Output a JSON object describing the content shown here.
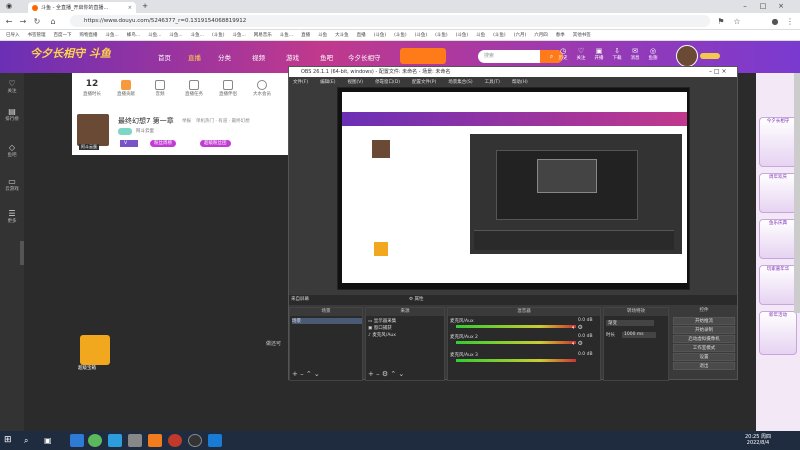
{
  "browser": {
    "tab_title": "斗鱼 - 全直播_开启你的直播...",
    "url": "https://www.douyu.com/5246377_r=0.1319154068819912",
    "bookmarks": [
      "已导入",
      "书签管理",
      "百度一下",
      "购物直播",
      "斗鱼...",
      "蜂鸟...",
      "斗鱼...",
      "斗鱼...",
      "斗鱼...",
      "(斗鱼)",
      "斗鱼...",
      "网易音乐",
      "斗鱼...",
      "直播",
      "斗鱼",
      "大斗鱼",
      "直播",
      "(斗鱼)",
      "(斗鱼)",
      "(斗鱼)",
      "(斗鱼)",
      "(斗鱼)",
      "斗鱼",
      "(斗鱼)",
      "(六月)",
      "六月四",
      "春季",
      "其他书签"
    ]
  },
  "site": {
    "logo": "今夕长相守 斗鱼",
    "nav": [
      "首页",
      "直播",
      "分类",
      "视频",
      "游戏",
      "鱼吧",
      "今夕长相守"
    ],
    "search_placeholder": "搜索",
    "header_icons": [
      {
        "label": "历史",
        "icon": "clock-icon"
      },
      {
        "label": "关注",
        "icon": "heart-icon"
      },
      {
        "label": "开播",
        "icon": "camera-icon"
      },
      {
        "label": "下载",
        "icon": "download-icon"
      },
      {
        "label": "消息",
        "icon": "bell-icon"
      },
      {
        "label": "鱼翅",
        "icon": "coin-icon"
      }
    ],
    "left_nav": [
      {
        "label": "关注",
        "icon": "heart-icon"
      },
      {
        "label": "排行榜",
        "icon": "rank-icon"
      },
      {
        "label": "鱼吧",
        "icon": "fish-icon"
      },
      {
        "label": "云游戏",
        "icon": "gamepad-icon"
      },
      {
        "label": "更多",
        "icon": "more-icon"
      }
    ]
  },
  "panel": {
    "stats": [
      {
        "value": "12",
        "label": "直播时长"
      },
      {
        "value": "",
        "label": "直播贡献"
      },
      {
        "value": "",
        "label": "音频"
      },
      {
        "value": "",
        "label": "直播任务"
      },
      {
        "value": "",
        "label": "直播伴侣"
      },
      {
        "value": "",
        "label": "大水会员"
      }
    ],
    "stream_title": "最终幻想7 第一章",
    "tag": "举报",
    "category": "单机热门 · 有道 · 最终幻想",
    "streamer": "阿斗云蛋",
    "level": "V",
    "btn1": "粉丝周榜",
    "btn2": "超级粉丝团"
  },
  "right_banners": [
    "今夕长相守",
    "周年欢庆",
    "鱼乐庆典",
    "玩家嘉年华",
    "新年活动"
  ],
  "side_left_label": "超级宝箱",
  "obs": {
    "title": "OBS 26.1.1 (64-bit, windows) - 配置文件: 未命名 - 场景: 未命名",
    "menu": [
      "文件(F)",
      "编辑(E)",
      "视图(V)",
      "停靠窗口(D)",
      "配置文件(P)",
      "场景集合(S)",
      "工具(T)",
      "帮助(H)"
    ],
    "source_bar": "来自屏幕",
    "filter_label": "属性",
    "sec_scenes": "场景",
    "sec_sources": "来源",
    "sec_mixer": "混音器",
    "sec_trans": "转场特效",
    "sec_controls": "控件",
    "scene_item": "场景",
    "sources": [
      "显示器采集",
      "窗口捕获",
      "麦克风/Aux"
    ],
    "mixer": [
      {
        "name": "麦克风/Aux",
        "db": "0.0 dB"
      },
      {
        "name": "麦克风/Aux 2",
        "db": "0.0 dB"
      },
      {
        "name": "麦克风/Aux 3",
        "db": "0.0 dB"
      }
    ],
    "trans_value": "渐变",
    "trans_duration_label": "时长",
    "trans_duration": "1000 ms",
    "controls": [
      "开始推流",
      "开始录制",
      "启动虚拟摄像机",
      "工作室模式",
      "设置",
      "退出"
    ],
    "dark_caption": "做还可"
  },
  "taskbar": {
    "time": "20:25 周四",
    "date": "2022/8/4"
  }
}
